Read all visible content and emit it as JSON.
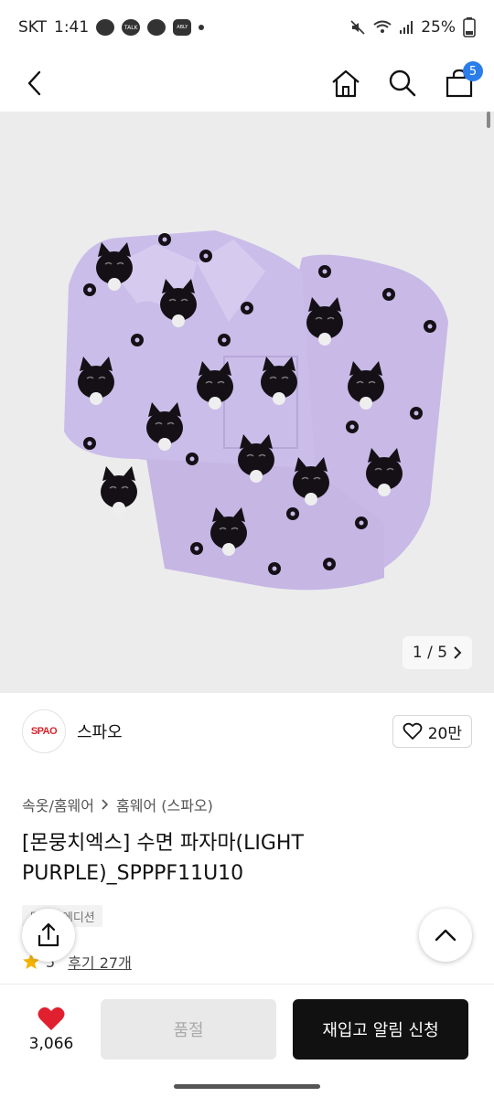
{
  "status_bar": {
    "carrier": "SKT",
    "time": "1:41",
    "notif_labels": [
      "TALK",
      "ABLY"
    ],
    "battery": "25%"
  },
  "nav": {
    "cart_count": "5"
  },
  "image": {
    "counter": "1 / 5"
  },
  "brand": {
    "logo_text": "SPAO",
    "name": "스파오",
    "like_count": "20만"
  },
  "breadcrumb": {
    "parent": "속옷/홈웨어",
    "child": "홈웨어 (스파오)"
  },
  "product": {
    "title": "[몬뭉치엑스] 수면 파자마(LIGHT PURPLE)_SPPPF11U10",
    "edition_tag": "몬뭉치에디션",
    "rating_partial": "5",
    "review_link": "후기 27개"
  },
  "bottom": {
    "wish_count": "3,066",
    "soldout_label": "품절",
    "restock_label": "재입고 알림 신청"
  },
  "colors": {
    "accent_blue": "#2b7de9",
    "heart_red": "#e0202f",
    "brand_red": "#d8232a",
    "pajama_purple": "#c8b9e6"
  }
}
